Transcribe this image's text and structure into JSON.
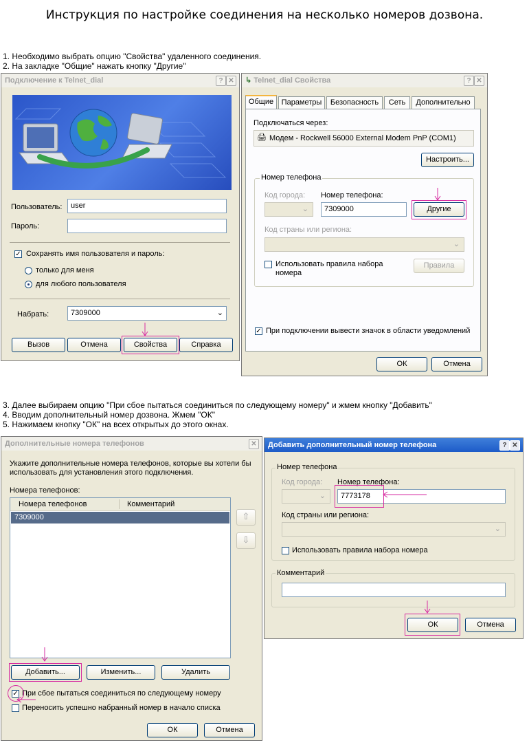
{
  "page_title": "Инструкция по настройке соединения на несколько номеров дозвона.",
  "steps_top": [
    "1. Необходимо выбрать опцию \"Свойства\" удаленного соединения.",
    "2. На закладке \"Общие\" нажать кнопку \"Другие\""
  ],
  "steps_bottom": [
    "3. Далее выбираем опцию \"При сбое пытаться соединиться по следующему номеру\" и жмем кнопку \"Добавить\"",
    "4. Вводим дополнительный номер дозвона. Жмем \"ОК\"",
    "5. Нажимаем кнопку \"ОК\" на всех открытых до этого окнах."
  ],
  "connect_dialog": {
    "title": "Подключение к Telnet_dial",
    "user_label": "Пользователь:",
    "user_value": "user",
    "password_label": "Пароль:",
    "password_value": "",
    "save_label": "Сохранять имя пользователя и пароль:",
    "save_checked": true,
    "radio_me": "только для меня",
    "radio_any": "для любого пользователя",
    "dial_label": "Набрать:",
    "dial_value": "7309000",
    "buttons": {
      "call": "Вызов",
      "cancel": "Отмена",
      "properties": "Свойства",
      "help": "Справка"
    }
  },
  "props_dialog": {
    "title": "Telnet_dial Свойства",
    "tabs": [
      "Общие",
      "Параметры",
      "Безопасность",
      "Сеть",
      "Дополнительно"
    ],
    "connect_via_label": "Подключаться через:",
    "modem": "Модем - Rockwell 56000 External Modem PnP (COM1)",
    "configure_button": "Настроить...",
    "phone_group": "Номер телефона",
    "area_code_label": "Код города:",
    "phone_label": "Номер телефона:",
    "phone_value": "7309000",
    "other_button": "Другие",
    "country_label": "Код страны или региона:",
    "use_rules_label": "Использовать правила набора номера",
    "rules_button": "Правила",
    "show_icon_label": "При подключении вывести значок в области уведомлений",
    "ok": "ОК",
    "cancel": "Отмена"
  },
  "alt_dialog": {
    "title": "Дополнительные номера телефонов",
    "description": "Укажите дополнительные номера телефонов, которые вы хотели бы использовать для установления этого подключения.",
    "numbers_label": "Номера телефонов:",
    "columns": [
      "Номера телефонов",
      "Комментарий"
    ],
    "rows": [
      "7309000"
    ],
    "add": "Добавить...",
    "edit": "Изменить...",
    "delete": "Удалить",
    "fallback_label": "При сбое пытаться соединиться по следующему номеру",
    "move_label": "Переносить успешно набранный номер в начало списка",
    "ok": "ОК",
    "cancel": "Отмена"
  },
  "add_dialog": {
    "title": "Добавить дополнительный номер телефона",
    "phone_group": "Номер телефона",
    "area_code_label": "Код города:",
    "phone_label": "Номер телефона:",
    "phone_value": "7773178",
    "country_label": "Код страны или региона:",
    "use_rules_label": "Использовать правила набора номера",
    "comment_group": "Комментарий",
    "ok": "ОК",
    "cancel": "Отмена"
  },
  "colors": {
    "highlight": "#d62aa0",
    "xp_blue": "#1d5bc8",
    "selected_row": "#566b8a"
  }
}
